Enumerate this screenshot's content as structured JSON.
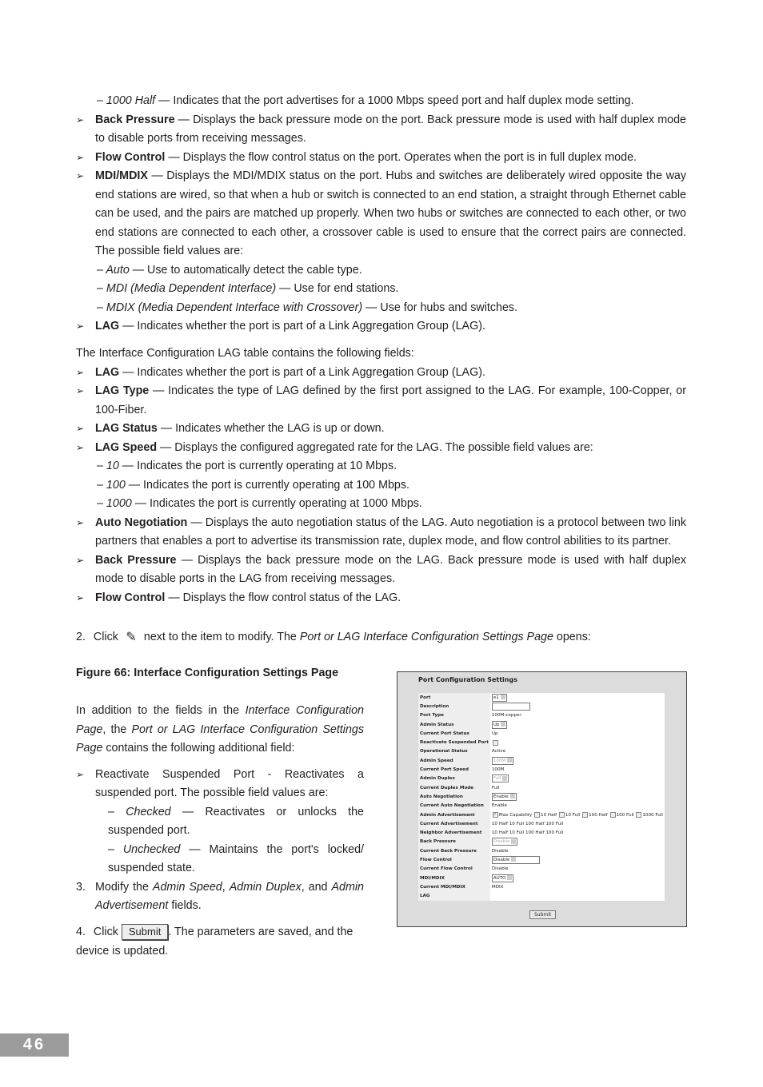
{
  "section1": [
    {
      "k": "sub",
      "runs": [
        {
          "t": "– 1000 Half",
          "s": "i"
        },
        {
          "t": " — Indicates that the port advertises for a 1000 Mbps speed port and half duplex mode setting."
        }
      ]
    },
    {
      "k": "bul",
      "runs": [
        {
          "t": "Back Pressure",
          "s": "b"
        },
        {
          "t": " — Displays the back pressure mode on the port. Back pressure mode is used with half duplex mode to disable ports from receiving messages."
        }
      ]
    },
    {
      "k": "bul",
      "runs": [
        {
          "t": "Flow Control",
          "s": "b"
        },
        {
          "t": " — Displays the flow control status on the port. Operates when the port is in full duplex mode."
        }
      ]
    },
    {
      "k": "bul",
      "runs": [
        {
          "t": "MDI/MDIX",
          "s": "b"
        },
        {
          "t": " — Displays the MDI/MDIX status on the port. Hubs and switches are deliberately wired opposite the way end stations are wired, so that when a hub or switch is connected to an end station, a straight through Ethernet cable can be used, and the pairs are matched up properly. When two hubs or switches are connected to each other, or two end stations are connected to each other, a crossover cable is used to ensure that the correct pairs are connected. The possible field values are:"
        }
      ]
    },
    {
      "k": "sub",
      "runs": [
        {
          "t": "– Auto",
          "s": "i"
        },
        {
          "t": " — Use to automatically detect the cable type."
        }
      ]
    },
    {
      "k": "sub",
      "runs": [
        {
          "t": "– MDI (Media Dependent Interface)",
          "s": "i"
        },
        {
          "t": " — Use for end stations."
        }
      ]
    },
    {
      "k": "sub",
      "runs": [
        {
          "t": "– MDIX (Media Dependent Interface with Crossover)",
          "s": "i"
        },
        {
          "t": " — Use for hubs and switches."
        }
      ]
    },
    {
      "k": "bul",
      "runs": [
        {
          "t": "LAG",
          "s": "b"
        },
        {
          "t": " — Indicates whether the port is part of a Link Aggregation Group (LAG)."
        }
      ]
    }
  ],
  "section2": [
    {
      "k": "para",
      "runs": [
        {
          "t": "The Interface Configuration LAG table contains the following fields:"
        }
      ]
    },
    {
      "k": "bul",
      "runs": [
        {
          "t": "LAG",
          "s": "b"
        },
        {
          "t": " — Indicates whether the port is part of a Link Aggregation Group (LAG)."
        }
      ]
    },
    {
      "k": "bul",
      "runs": [
        {
          "t": "LAG Type",
          "s": "b"
        },
        {
          "t": " — Indicates the type of LAG defined by the first port assigned to the LAG. For example, 100-Copper, or 100-Fiber."
        }
      ]
    },
    {
      "k": "bul",
      "runs": [
        {
          "t": "LAG Status",
          "s": "b"
        },
        {
          "t": " — Indicates whether the LAG is up or down."
        }
      ]
    },
    {
      "k": "bul",
      "runs": [
        {
          "t": "LAG Speed",
          "s": "b"
        },
        {
          "t": " — Displays the configured aggregated rate for the LAG. The possible field values are:"
        }
      ]
    },
    {
      "k": "sub",
      "runs": [
        {
          "t": "– 10",
          "s": "i"
        },
        {
          "t": " — Indicates the port is currently operating at 10 Mbps."
        }
      ]
    },
    {
      "k": "sub",
      "runs": [
        {
          "t": "– 100",
          "s": "i"
        },
        {
          "t": " — Indicates the port is currently operating at 100 Mbps."
        }
      ]
    },
    {
      "k": "sub",
      "runs": [
        {
          "t": "– 1000",
          "s": "i"
        },
        {
          "t": " — Indicates the port is currently operating at 1000 Mbps."
        }
      ]
    },
    {
      "k": "bul",
      "runs": [
        {
          "t": "Auto Negotiation",
          "s": "b"
        },
        {
          "t": " — Displays the auto negotiation status of the LAG. Auto negotiation is a protocol between two link partners that enables a port to advertise its transmission rate, duplex mode, and flow control abilities to its partner."
        }
      ]
    },
    {
      "k": "bul",
      "runs": [
        {
          "t": "Back Pressure",
          "s": "b"
        },
        {
          "t": " — Displays the back pressure mode on the LAG. Back pressure mode is used with half duplex mode to disable ports in the LAG from receiving messages."
        }
      ]
    },
    {
      "k": "bul",
      "runs": [
        {
          "t": "Flow Control",
          "s": "b"
        },
        {
          "t": " — Displays the flow control status of the LAG."
        }
      ]
    }
  ],
  "step2": {
    "num": "2.",
    "pre": "Click",
    "post": "next to the item to modify. The ",
    "ital": "Port or LAG Interface Configuration Settings Page",
    "end": " opens:",
    "icon": "pencil-edit-icon"
  },
  "figure_caption": "Figure 66: Interface Configuration Settings Page",
  "left_col": [
    {
      "k": "para",
      "runs": [
        {
          "t": "In addition to the fields in the "
        },
        {
          "t": "Interface Configuration Page",
          "s": "i"
        },
        {
          "t": ", the "
        },
        {
          "t": "Port or LAG Interface Configuration Settings Page",
          "s": "i"
        },
        {
          "t": " contains the following additional field:"
        }
      ]
    },
    {
      "k": "bul",
      "runs": [
        {
          "t": "Reactivate Suspended Port - Reactivates a suspended port. The possible field values are:"
        }
      ]
    },
    {
      "k": "sub2",
      "runs": [
        {
          "t": "– Checked",
          "s": "i"
        },
        {
          "t": " — Reactivates or unlocks the suspended port."
        }
      ]
    },
    {
      "k": "sub2",
      "runs": [
        {
          "t": "– Unchecked",
          "s": "i"
        },
        {
          "t": " — Maintains the port's locked/ suspended state."
        }
      ]
    },
    {
      "k": "bul",
      "num": "3.",
      "runs": [
        {
          "t": "Modify the "
        },
        {
          "t": "Admin Speed",
          "s": "i"
        },
        {
          "t": ", "
        },
        {
          "t": "Admin Duplex",
          "s": "i"
        },
        {
          "t": ", and "
        },
        {
          "t": "Admin Advertisement",
          "s": "i"
        },
        {
          "t": " fields."
        }
      ]
    }
  ],
  "step4": {
    "num": "4.",
    "pre": "Click",
    "button": "Submit",
    "post": ". The parameters are saved, and the device is updated."
  },
  "screenshot": {
    "title": "Port Configuration Settings",
    "rows": [
      {
        "label": "Port",
        "type": "select",
        "value": "e1"
      },
      {
        "label": "Description",
        "type": "text",
        "value": ""
      },
      {
        "label": "Port Type",
        "type": "static",
        "value": "100M-copper"
      },
      {
        "label": "Admin Status",
        "type": "select",
        "value": "Up"
      },
      {
        "label": "Current Port Status",
        "type": "static",
        "value": "Up"
      },
      {
        "label": "Reactivate Suspended Port",
        "type": "checkbox",
        "value": ""
      },
      {
        "label": "Operational Status",
        "type": "static",
        "value": "Active"
      },
      {
        "label": "Admin Speed",
        "type": "select-disabled",
        "value": "100M"
      },
      {
        "label": "Current Port Speed",
        "type": "static",
        "value": "100M"
      },
      {
        "label": "Admin Duplex",
        "type": "select-disabled",
        "value": "Full"
      },
      {
        "label": "Current Duplex Mode",
        "type": "static",
        "value": "Full"
      },
      {
        "label": "Auto Negotiation",
        "type": "select",
        "value": "Enable"
      },
      {
        "label": "Current Auto Negotiation",
        "type": "static",
        "value": "Enable"
      },
      {
        "label": "Admin Advertisement",
        "type": "checks",
        "options": [
          {
            "t": "Max Capability",
            "c": true
          },
          {
            "t": "10 Half",
            "c": false
          },
          {
            "t": "10 Full",
            "c": false
          },
          {
            "t": "100 Half",
            "c": false
          },
          {
            "t": "100 Full",
            "c": false
          },
          {
            "t": "1000 Full",
            "c": false
          }
        ]
      },
      {
        "label": "Current Advertisement",
        "type": "static",
        "value": "10 Half 10 Full 100 Half 100 Full"
      },
      {
        "label": "Neighbor Advertisement",
        "type": "static",
        "value": "10 Half 10 Full 100 Half 100 Full"
      },
      {
        "label": "Back Pressure",
        "type": "select-disabled",
        "value": "Disable"
      },
      {
        "label": "Current Back Pressure",
        "type": "static",
        "value": "Disable"
      },
      {
        "label": "Flow Control",
        "type": "select-wide",
        "value": "Disable"
      },
      {
        "label": "Current Flow Control",
        "type": "static",
        "value": "Disable"
      },
      {
        "label": "MDI/MDIX",
        "type": "select",
        "value": "AUTO"
      },
      {
        "label": "Current MDI/MDIX",
        "type": "static",
        "value": "MDIX"
      },
      {
        "label": "LAG",
        "type": "static",
        "value": ""
      }
    ],
    "submit": "Submit"
  },
  "page_number": "46"
}
